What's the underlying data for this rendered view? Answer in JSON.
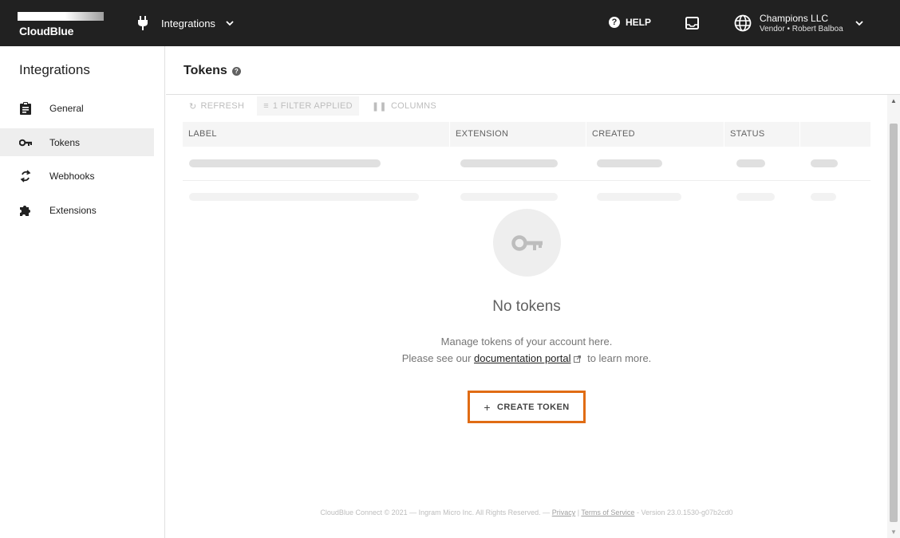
{
  "topbar": {
    "logo_text": "CloudBlue",
    "module_label": "Integrations",
    "help_label": "HELP",
    "account_org": "Champions LLC",
    "account_sub": "Vendor • Robert Balboa",
    "icons": [
      "plug-icon",
      "chevron-down-icon",
      "help-icon",
      "inbox-icon",
      "globe-icon"
    ]
  },
  "sidebar": {
    "title": "Integrations",
    "items": [
      {
        "label": "General",
        "icon": "clipboard-icon",
        "active": false
      },
      {
        "label": "Tokens",
        "icon": "key-icon",
        "active": true
      },
      {
        "label": "Webhooks",
        "icon": "sync-icon",
        "active": false
      },
      {
        "label": "Extensions",
        "icon": "puzzle-icon",
        "active": false
      }
    ]
  },
  "page": {
    "title": "Tokens",
    "toolbar": {
      "refresh": "REFRESH",
      "filter": "1 FILTER APPLIED",
      "columns": "COLUMNS"
    },
    "table": {
      "columns": [
        "LABEL",
        "EXTENSION",
        "CREATED",
        "STATUS",
        ""
      ]
    },
    "empty": {
      "title": "No tokens",
      "line1": "Manage tokens of your account here.",
      "line2_prefix": "Please see our",
      "link": "documentation portal",
      "line2_suffix": "to learn more.",
      "button": "CREATE TOKEN"
    },
    "footer": {
      "prefix": "CloudBlue Connect © 2021 — Ingram Micro Inc. All Rights Reserved. —",
      "privacy": "Privacy",
      "sep": "|",
      "terms": "Terms of Service",
      "version": "- Version 23.0.1530-g07b2cd0"
    }
  },
  "colors": {
    "topbar": "#212121",
    "highlight": "#e06c14",
    "active_nav": "#eeeeee"
  }
}
